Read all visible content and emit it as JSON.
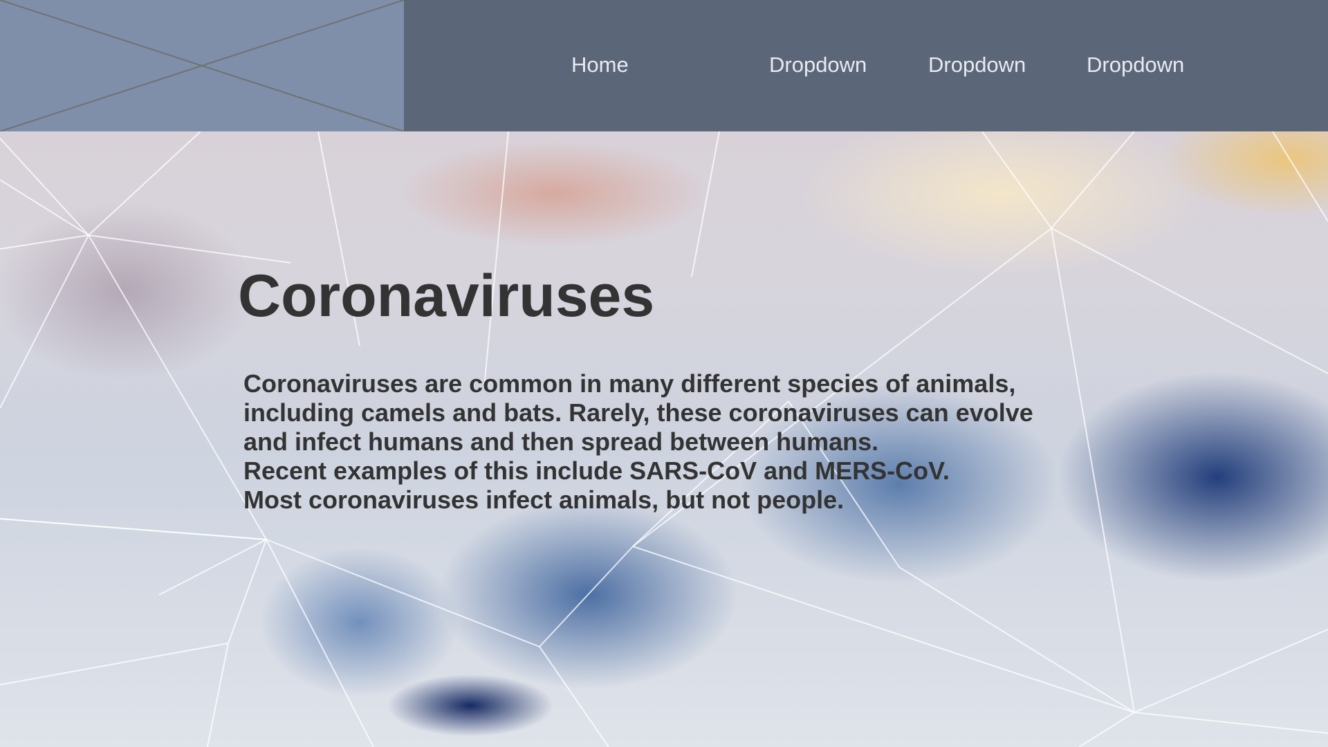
{
  "header": {
    "logo": "image-placeholder",
    "nav": [
      {
        "label": "Home"
      },
      {
        "label": "Dropdown"
      },
      {
        "label": "Dropdown"
      },
      {
        "label": "Dropdown"
      }
    ]
  },
  "hero": {
    "title": "Coronaviruses",
    "lines": [
      "Coronaviruses are common in many different species of animals,",
      "including camels and bats. Rarely, these coronaviruses can evolve",
      "and infect humans and then spread between humans.",
      "Recent examples of this include SARS-CoV and MERS-CoV.",
      "Most coronaviruses infect animals, but not people."
    ]
  },
  "colors": {
    "header_bg": "#5b6679",
    "logo_bg": "#7f8ea9",
    "nav_text": "#e8ebf0",
    "text_dark": "#333333"
  }
}
